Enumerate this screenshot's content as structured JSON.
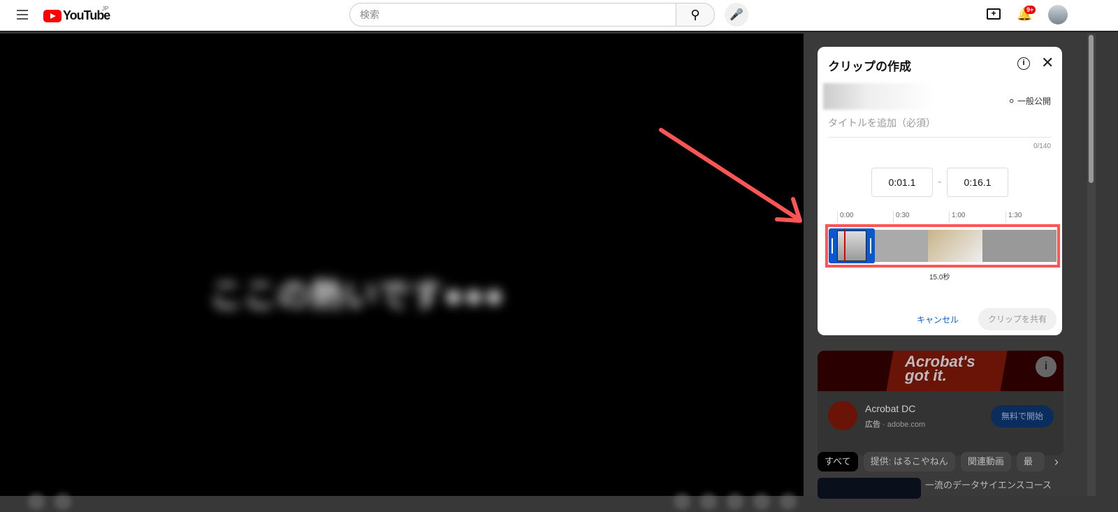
{
  "header": {
    "logo": "YouTube",
    "region": "JP",
    "search_placeholder": "検索",
    "notification_count": "9+"
  },
  "player": {
    "blurred_caption": "ここの熱いです●●●"
  },
  "clip_dialog": {
    "title": "クリップの作成",
    "visibility": "一般公開",
    "title_placeholder": "タイトルを追加（必須）",
    "char_count": "0/140",
    "start_time": "0:01.1",
    "end_time": "0:16.1",
    "separator": "-",
    "timeline_ticks": [
      "0:00",
      "0:30",
      "1:00",
      "1:30"
    ],
    "duration": "15.0秒",
    "cancel_label": "キャンセル",
    "share_label": "クリップを共有",
    "clip_start_fraction": 0.01,
    "highlight_color": "#ff5555",
    "arrow_color": "#ff5555"
  },
  "ad": {
    "banner_line1": "Acrobat's",
    "banner_line2": "got it.",
    "name": "Acrobat DC",
    "label": "広告",
    "domain": "adobe.com",
    "cta": "無料で開始"
  },
  "chips": [
    "すべて",
    "提供: はるこやねん",
    "関連動画",
    "最近"
  ],
  "next_video": {
    "title": "一流のデータサイエンスコース"
  }
}
